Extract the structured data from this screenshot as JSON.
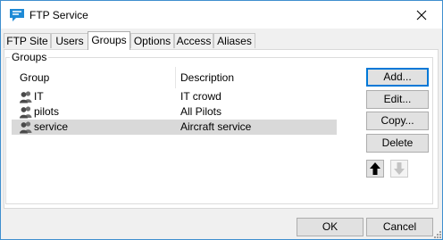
{
  "window": {
    "title": "FTP Service"
  },
  "tabs": [
    {
      "label": "FTP Site"
    },
    {
      "label": "Users"
    },
    {
      "label": "Groups"
    },
    {
      "label": "Options"
    },
    {
      "label": "Access"
    },
    {
      "label": "Aliases"
    }
  ],
  "active_tab": "Groups",
  "groups_box": {
    "label": "Groups",
    "columns": {
      "group": "Group",
      "description": "Description"
    },
    "rows": [
      {
        "group": "IT",
        "description": "IT crowd",
        "selected": false
      },
      {
        "group": "pilots",
        "description": "All Pilots",
        "selected": false
      },
      {
        "group": "service",
        "description": "Aircraft service",
        "selected": true
      }
    ]
  },
  "actions": {
    "add": "Add...",
    "edit": "Edit...",
    "copy": "Copy...",
    "delete": "Delete"
  },
  "footer": {
    "ok": "OK",
    "cancel": "Cancel"
  },
  "colors": {
    "accent": "#0078d7",
    "selection": "#d9d9d9",
    "border": "#3f8fcf"
  }
}
